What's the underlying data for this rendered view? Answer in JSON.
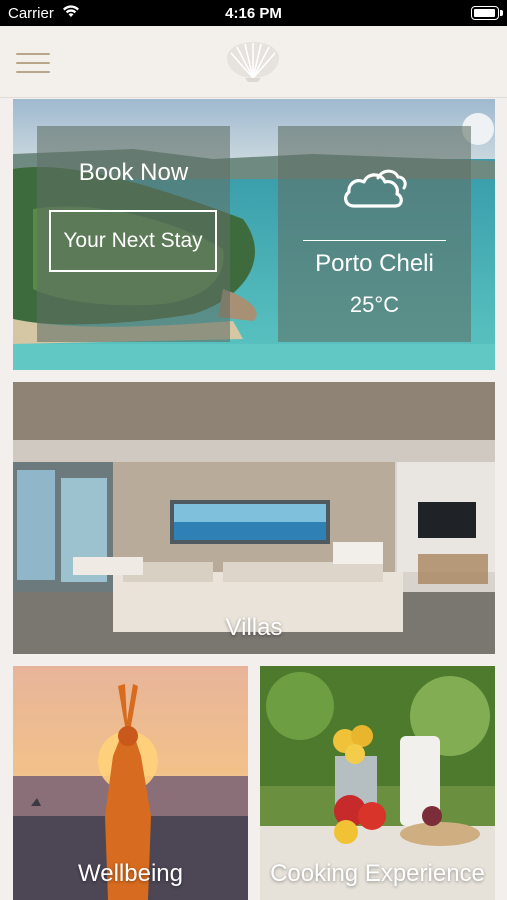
{
  "status_bar": {
    "carrier": "Carrier",
    "time": "4:16 PM"
  },
  "header": {
    "menu_icon": "hamburger-menu-icon",
    "logo_icon": "shell-logo-icon"
  },
  "hero": {
    "book_label": "Book Now",
    "stay_button": "Your Next Stay",
    "weather": {
      "icon": "cloud-icon",
      "city": "Porto Cheli",
      "temperature": "25°C"
    }
  },
  "cards": {
    "villas": "Villas",
    "wellbeing": "Wellbeing",
    "cooking": "Cooking Experience"
  },
  "colors": {
    "accent": "#b8a68a",
    "header_bg": "#f3f0ec",
    "sea": "#3fb3b6"
  }
}
